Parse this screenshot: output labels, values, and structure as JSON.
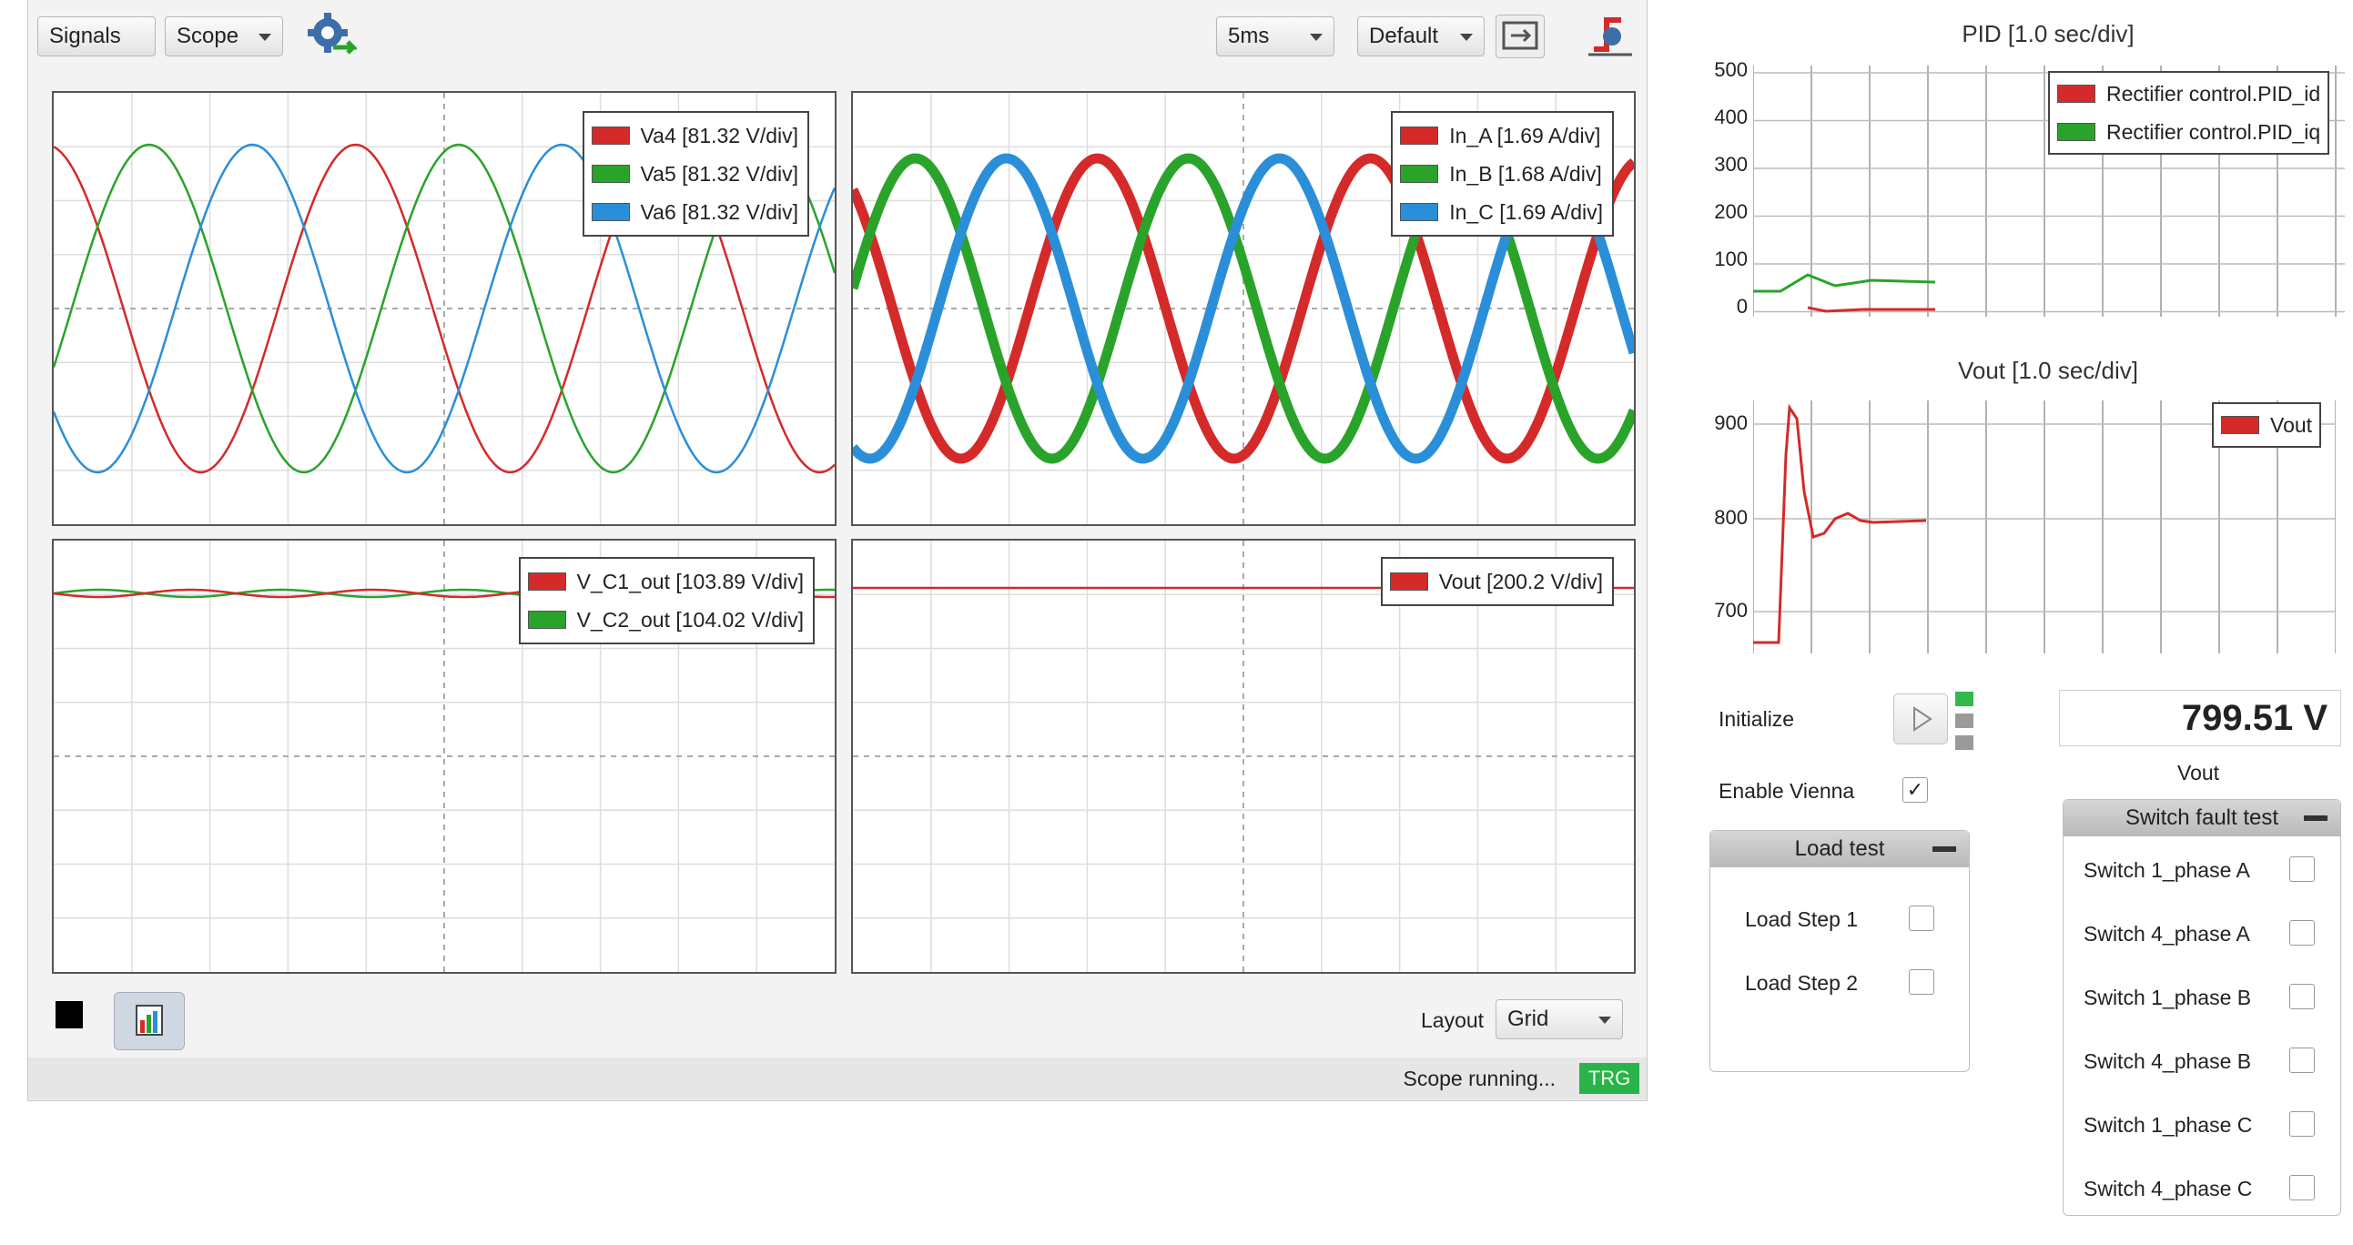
{
  "toolbar": {
    "signals_label": "Signals",
    "scope_label": "Scope",
    "timebase_value": "5ms",
    "preset_value": "Default"
  },
  "scope_plots": [
    {
      "legend": [
        {
          "label": "Va4 [81.32 V/div]",
          "color": "#d42a2a"
        },
        {
          "label": "Va5 [81.32 V/div]",
          "color": "#2aa32a"
        },
        {
          "label": "Va6 [81.32 V/div]",
          "color": "#2a8fd8"
        }
      ]
    },
    {
      "legend": [
        {
          "label": "In_A [1.69 A/div]",
          "color": "#d42a2a"
        },
        {
          "label": "In_B [1.68 A/div]",
          "color": "#2aa32a"
        },
        {
          "label": "In_C [1.69 A/div]",
          "color": "#2a8fd8"
        }
      ]
    },
    {
      "legend": [
        {
          "label": "V_C1_out [103.89 V/div]",
          "color": "#d42a2a"
        },
        {
          "label": "V_C2_out [104.02 V/div]",
          "color": "#2aa32a"
        }
      ]
    },
    {
      "legend": [
        {
          "label": "Vout [200.2 V/div]",
          "color": "#d42a2a"
        }
      ]
    }
  ],
  "layout": {
    "label": "Layout",
    "value": "Grid"
  },
  "status": {
    "text": "Scope running...",
    "trg": "TRG"
  },
  "pid_chart": {
    "title": "PID [1.0 sec/div]",
    "yticks": [
      "500",
      "400",
      "300",
      "200",
      "100",
      "0"
    ],
    "legend": [
      {
        "label": "Rectifier control.PID_id",
        "color": "#d42a2a"
      },
      {
        "label": "Rectifier control.PID_iq",
        "color": "#2aa32a"
      }
    ]
  },
  "vout_chart": {
    "title": "Vout [1.0 sec/div]",
    "yticks": [
      "900",
      "800",
      "700"
    ],
    "legend": [
      {
        "label": "Vout",
        "color": "#d42a2a"
      }
    ]
  },
  "controls": {
    "initialize_label": "Initialize",
    "enable_vienna_label": "Enable Vienna",
    "vout_display": "799.51 V",
    "vout_caption": "Vout",
    "load_test": {
      "title": "Load test",
      "items": [
        "Load Step 1",
        "Load Step 2"
      ]
    },
    "switch_fault_test": {
      "title": "Switch fault test",
      "items": [
        "Switch 1_phase A",
        "Switch 4_phase A",
        "Switch 1_phase B",
        "Switch 4_phase B",
        "Switch 1_phase C",
        "Switch 4_phase C"
      ]
    }
  }
}
